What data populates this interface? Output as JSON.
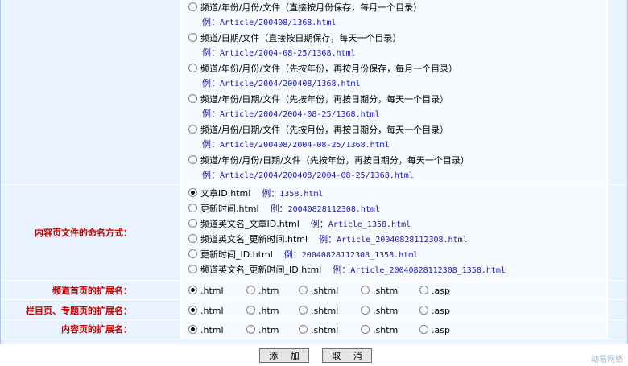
{
  "directory_options": [
    {
      "label": "频道/年份/月份/文件（直接按月份保存，每月一个目录）",
      "example_label": "例：",
      "example": "Article/200408/1368.html"
    },
    {
      "label": "频道/日期/文件（直接按日期保存，每天一个目录）",
      "example_label": "例：",
      "example": "Article/2004-08-25/1368.html"
    },
    {
      "label": "频道/年份/月份/文件（先按年份，再按月份保存，每月一个目录）",
      "example_label": "例：",
      "example": "Article/2004/200408/1368.html"
    },
    {
      "label": "频道/年份/日期/文件（先按年份，再按日期分，每天一个目录）",
      "example_label": "例：",
      "example": "Article/2004/2004-08-25/1368.html"
    },
    {
      "label": "频道/月份/日期/文件（先按月份，再按日期分，每天一个目录）",
      "example_label": "例：",
      "example": "Article/200408/2004-08-25/1368.html"
    },
    {
      "label": "频道/年份/月份/日期/文件（先按年份，再按日期分，每天一个目录）",
      "example_label": "例：",
      "example": "Article/2004/200408/2004-08-25/1368.html"
    }
  ],
  "naming": {
    "label": "内容页文件的命名方式：",
    "options": [
      {
        "label": "文章ID.html",
        "example_label": "例：",
        "example": "1358.html",
        "checked": true
      },
      {
        "label": "更新时间.html",
        "example_label": "例：",
        "example": "20040828112308.html",
        "checked": false
      },
      {
        "label": "频道英文名_文章ID.html",
        "example_label": "例：",
        "example": "Article_1358.html",
        "checked": false
      },
      {
        "label": "频道英文名_更新时间.html",
        "example_label": "例：",
        "example": "Article_20040828112308.html",
        "checked": false
      },
      {
        "label": "更新时间_ID.html",
        "example_label": "例：",
        "example": "20040828112308_1358.html",
        "checked": false
      },
      {
        "label": "频道英文名_更新时间_ID.html",
        "example_label": "例：",
        "example": "Article_20040828112308_1358.html",
        "checked": false
      }
    ]
  },
  "ext_rows": [
    {
      "label": "频道首页的扩展名："
    },
    {
      "label": "栏目页、专题页的扩展名："
    },
    {
      "label": "内容页的扩展名："
    }
  ],
  "extensions": [
    ".html",
    ".htm",
    ".shtml",
    ".shtm",
    ".asp"
  ],
  "buttons": {
    "add": "添 加",
    "cancel": "取 消"
  },
  "watermark": "动易网络"
}
